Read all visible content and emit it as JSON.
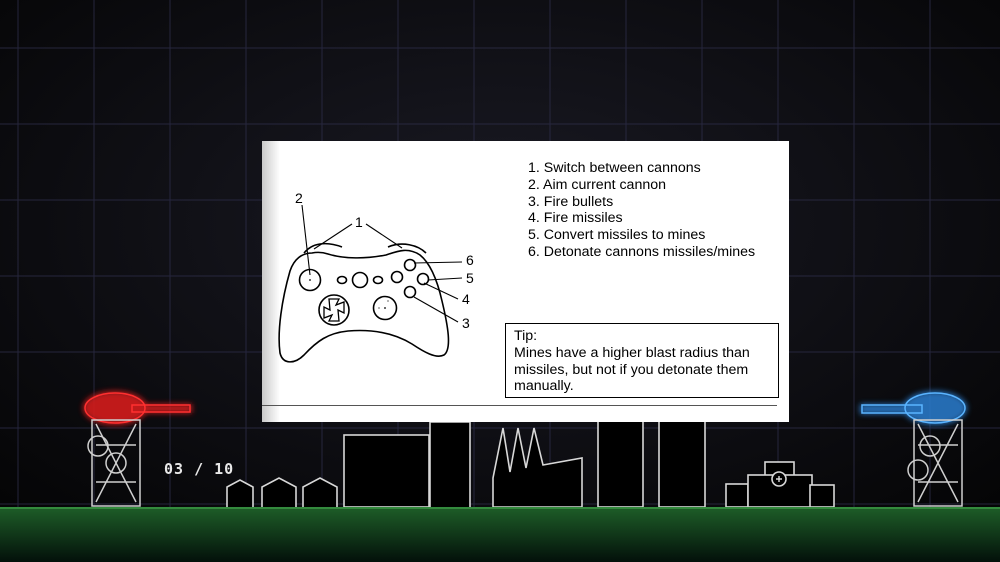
{
  "tutorial": {
    "controls": [
      "1. Switch between cannons",
      "2. Aim current cannon",
      "3. Fire bullets",
      "4. Fire missiles",
      "5. Convert missiles to mines",
      "6. Detonate cannons missiles/mines"
    ],
    "callouts": [
      "1",
      "2",
      "3",
      "4",
      "5",
      "6"
    ],
    "tip_title": "Tip:",
    "tip_text": "Mines have a higher blast radius than missiles, but not if you detonate them manually."
  },
  "hud": {
    "round_counter": "03 / 10"
  },
  "colors": {
    "grid": "#2a2a44",
    "player_red": "#ff2a2a",
    "player_blue": "#3aa0ff",
    "ground": "#1d6b2a",
    "outline": "#d8d8d8"
  }
}
